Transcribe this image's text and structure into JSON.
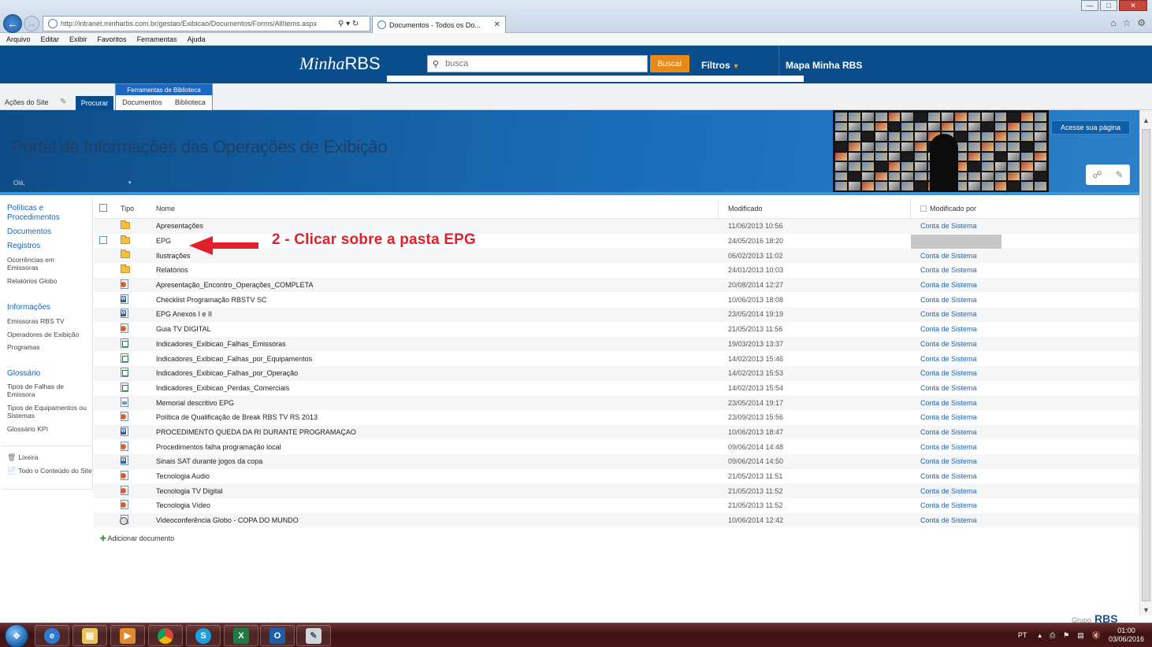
{
  "browser": {
    "url": "http://intranet.minharbs.com.br/gestao/Exibicao/Documentos/Forms/AllItems.aspx",
    "tab_title": "Documentos - Todos os Do...",
    "menu": [
      "Arquivo",
      "Editar",
      "Exibir",
      "Favoritos",
      "Ferramentas",
      "Ajuda"
    ]
  },
  "header": {
    "logo_script": "Minha",
    "logo_bold": "RBS",
    "search_placeholder": "busca",
    "search_button": "Buscar",
    "filters": "Filtros",
    "map_link": "Mapa Minha RBS"
  },
  "ribbon": {
    "site_actions": "Ações do Site",
    "browse_tab": "Procurar",
    "tools_group": "Ferramentas de Biblioteca",
    "documents_tab": "Documentos",
    "library_tab": "Biblioteca"
  },
  "banner": {
    "title": "Portal de Informações das Operações de Exibição",
    "greeting": "Olá,",
    "access_button": "Acesse sua página"
  },
  "leftnav": {
    "sections": [
      {
        "head": "Políticas e Procedimentos"
      },
      {
        "head": "Documentos"
      },
      {
        "head": "Registros",
        "items": [
          "Ocorrências em Emissoras",
          "Relatórios Globo"
        ]
      },
      {
        "head": "Informações",
        "items": [
          "Emissoras RBS TV",
          "Operadores de Exibição",
          "Programas"
        ]
      },
      {
        "head": "Glossário",
        "items": [
          "Tipos de Falhas de Emissora",
          "Tipos de Equipamentos ou Sistemas",
          "Glossário KPI"
        ]
      }
    ],
    "recycle_bin": "Lixeira",
    "all_content": "Todo o Conteúdo do Site"
  },
  "list": {
    "columns": {
      "tipo": "Tipo",
      "nome": "Nome",
      "modificado": "Modificado",
      "modificado_por": "Modificado por"
    },
    "rows": [
      {
        "icon": "folder",
        "name": "Apresentações",
        "modified": "11/06/2013 10:56",
        "by": "Conta de Sistema"
      },
      {
        "icon": "folder",
        "name": "EPG",
        "modified": "24/05/2016 18:20",
        "by": ""
      },
      {
        "icon": "folder",
        "name": "Ilustrações",
        "modified": "06/02/2013 11:02",
        "by": "Conta de Sistema"
      },
      {
        "icon": "folder",
        "name": "Relatórios",
        "modified": "24/01/2013 10:03",
        "by": "Conta de Sistema"
      },
      {
        "icon": "ppt",
        "name": "Apresentação_Encontro_Operações_COMPLETA",
        "modified": "20/08/2014 12:27",
        "by": "Conta de Sistema"
      },
      {
        "icon": "word",
        "name": "Checklist Programação RBSTV SC",
        "modified": "10/06/2013 18:08",
        "by": "Conta de Sistema"
      },
      {
        "icon": "word",
        "name": "EPG Anexos I e II",
        "modified": "23/05/2014 19:19",
        "by": "Conta de Sistema"
      },
      {
        "icon": "ppt",
        "name": "Guia TV DIGITAL",
        "modified": "21/05/2013 11:56",
        "by": "Conta de Sistema"
      },
      {
        "icon": "xlsx",
        "name": "Indicadores_Exibicao_Falhas_Emissoras",
        "modified": "19/03/2013 13:37",
        "by": "Conta de Sistema"
      },
      {
        "icon": "xlsx",
        "name": "Indicadores_Exibicao_Falhas_por_Equipamentos",
        "modified": "14/02/2013 15:46",
        "by": "Conta de Sistema"
      },
      {
        "icon": "xlsx",
        "name": "Indicadores_Exibicao_Falhas_por_Operação",
        "modified": "14/02/2013 15:53",
        "by": "Conta de Sistema"
      },
      {
        "icon": "xlsx",
        "name": "Indicadores_Exibicao_Perdas_Comerciais",
        "modified": "14/02/2013 15:54",
        "by": "Conta de Sistema"
      },
      {
        "icon": "img",
        "name": "Memorial descritivo EPG",
        "modified": "23/05/2014 19:17",
        "by": "Conta de Sistema"
      },
      {
        "icon": "ppt",
        "name": "Política de Qualificação de Break RBS TV RS 2013",
        "modified": "23/09/2013 15:56",
        "by": "Conta de Sistema"
      },
      {
        "icon": "word",
        "name": "PROCEDIMENTO QUEDA DA RI DURANTE PROGRAMAÇAO",
        "modified": "10/06/2013 18:47",
        "by": "Conta de Sistema"
      },
      {
        "icon": "ppt",
        "name": "Procedimentos falha programação local",
        "modified": "09/06/2014 14:48",
        "by": "Conta de Sistema"
      },
      {
        "icon": "word",
        "name": "Sinais SAT durante jogos da copa",
        "modified": "09/06/2014 14:50",
        "by": "Conta de Sistema"
      },
      {
        "icon": "ppt",
        "name": "Tecnologia Audio",
        "modified": "21/05/2013 11:51",
        "by": "Conta de Sistema"
      },
      {
        "icon": "ppt",
        "name": "Tecnologia TV Digital",
        "modified": "21/05/2013 11:52",
        "by": "Conta de Sistema"
      },
      {
        "icon": "ppt",
        "name": "Tecnologia Vídeo",
        "modified": "21/05/2013 11:52",
        "by": "Conta de Sistema"
      },
      {
        "icon": "video",
        "name": "Videoconferência Globo - COPA DO MUNDO",
        "modified": "10/06/2014 12:42",
        "by": "Conta de Sistema"
      }
    ],
    "add_document": "Adicionar documento"
  },
  "annotation": {
    "text": "2 - Clicar sobre a pasta EPG",
    "color": "#e0202a"
  },
  "footer": {
    "brand": "RBS"
  },
  "taskbar": {
    "apps": [
      "ie",
      "explorer",
      "media-player",
      "chrome",
      "skype",
      "excel",
      "outlook",
      "paint"
    ],
    "language": "PT",
    "time": "01:00",
    "date": "03/06/2016"
  }
}
